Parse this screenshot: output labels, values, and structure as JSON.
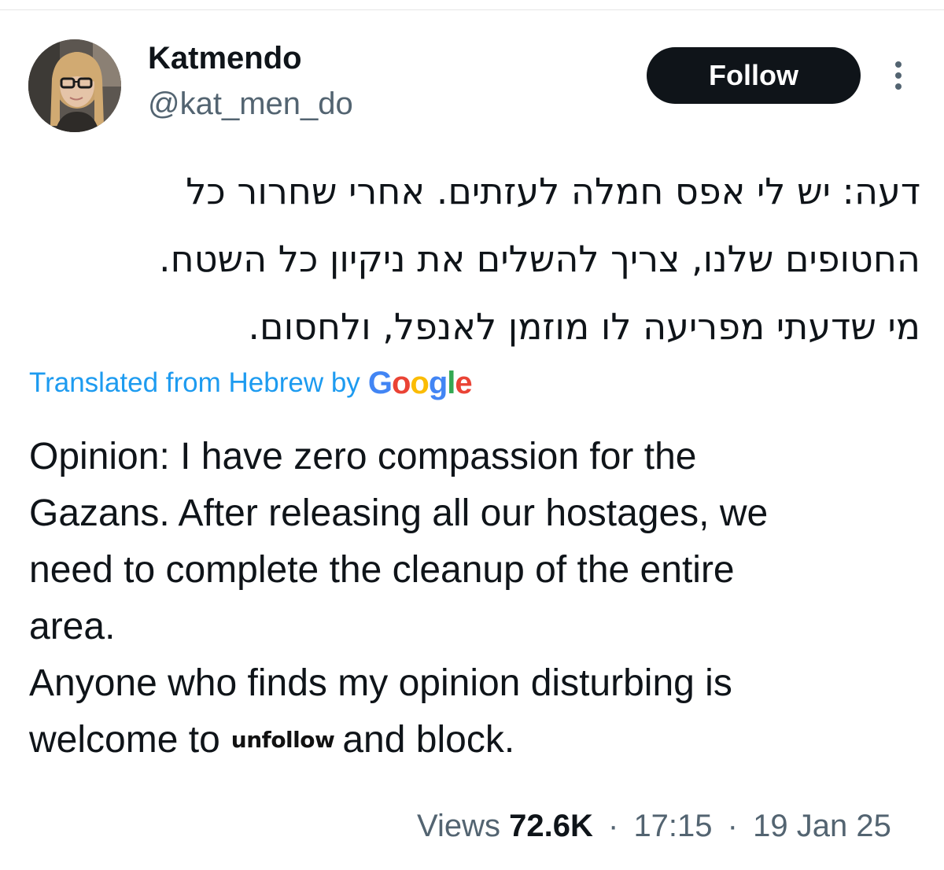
{
  "author": {
    "display_name": "Katmendo",
    "handle": "@kat_men_do",
    "avatar_icon": "profile-photo"
  },
  "follow_label": "Follow",
  "more_icon": "more-options-icon",
  "post": {
    "original_lines": [
      "דעה: יש לי אפס חמלה לעזתים. אחרי שחרור כל",
      "החטופים שלנו, צריך להשלים את ניקיון כל השטח.",
      "מי שדעתי מפריעה לו מוזמן לאנפל, ולחסום."
    ],
    "translation_label": "Translated from Hebrew by",
    "translation_provider": "Google",
    "translated_lines": [
      "Opinion: I have zero compassion for the",
      "Gazans. After releasing all our hostages, we",
      "need to complete the cleanup of the entire",
      "area.",
      "Anyone who finds my opinion disturbing is"
    ],
    "last_line_start": "welcome to",
    "overlay_word": "unfollow",
    "last_line_end": "and block."
  },
  "meta": {
    "views_label": "Views",
    "views_count": "72.6K",
    "separator": "·",
    "time": "17:15",
    "date": "19 Jan 25"
  },
  "colors": {
    "link": "#1d9bf0",
    "secondary_text": "#536471",
    "primary_text": "#0f1419",
    "button_bg": "#0f1419",
    "google_blue": "#4285f4",
    "google_red": "#ea4335",
    "google_yellow": "#fbbc05",
    "google_green": "#34a853"
  }
}
